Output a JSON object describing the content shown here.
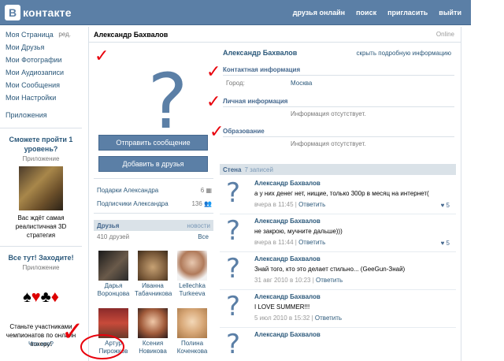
{
  "header": {
    "logo_letter": "В",
    "logo_text": "контакте",
    "nav": [
      "друзья онлайн",
      "поиск",
      "пригласить",
      "выйти"
    ]
  },
  "leftmenu": {
    "items": [
      "Моя Страница",
      "Мои Друзья",
      "Мои Фотографии",
      "Мои Аудиозаписи",
      "Мои Сообщения",
      "Мои Настройки"
    ],
    "edit": "ред.",
    "apps": "Приложения"
  },
  "ads": [
    {
      "title": "Сможете пройти 1 уровень?",
      "sub": "Приложение",
      "text": "Вас ждёт самая реалистичная 3D стратегия"
    },
    {
      "title": "Все тут! Заходите!",
      "sub": "Приложение",
      "text": "Станьте участниками чемпионатов по онлайн покеру!"
    }
  ],
  "whatisit": "Что это?",
  "profile": {
    "name": "Александр Бахвалов",
    "status": "Online",
    "send_message": "Отправить сообщение",
    "add_friend": "Добавить в друзья",
    "gifts_label": "Подарки Александра",
    "gifts_count": "6",
    "subs_label": "Подписчики Александра",
    "subs_count": "136"
  },
  "friends": {
    "title": "Друзья",
    "new": "новости",
    "count": "410 друзей",
    "all": "Все",
    "list": [
      {
        "first": "Дарья",
        "last": "Воронцова"
      },
      {
        "first": "Иванна",
        "last": "Табачникова"
      },
      {
        "first": "Lellechka",
        "last": "Turkeeva"
      },
      {
        "first": "Артур",
        "last": "Пирожков"
      },
      {
        "first": "Ксения",
        "last": "Новикова"
      },
      {
        "first": "Полина",
        "last": "Коченкова"
      }
    ]
  },
  "info": {
    "name": "Александр Бахвалов",
    "hide": "скрыть подробную информацию",
    "contact": "Контактная информация",
    "city_label": "Город:",
    "city": "Москва",
    "personal": "Личная информация",
    "none1": "Информация отсутствует.",
    "education": "Образование",
    "none2": "Информация отсутствует."
  },
  "wall": {
    "title": "Стена",
    "count": "7 записей",
    "posts": [
      {
        "author": "Александр Бахвалов",
        "text": "а у них денег нет, нищие, только 300р в месяц на интернет(",
        "date": "вчера в 11:45",
        "reply": "Ответить",
        "likes": "5"
      },
      {
        "author": "Александр Бахвалов",
        "text": "не закрою, мучните дальше)))",
        "date": "вчера в 11:44",
        "reply": "Ответить",
        "likes": "5"
      },
      {
        "author": "Александр Бахвалов",
        "text": "Знай того, кто это делает стильно... (GeeGun-Знай)",
        "date": "31 авг 2010 в 10:23",
        "reply": "Ответить",
        "likes": ""
      },
      {
        "author": "Александр Бахвалов",
        "text": "I LOVE SUMMER!!!",
        "date": "5 июл 2010 в 15:32",
        "reply": "Ответить",
        "likes": ""
      },
      {
        "author": "Александр Бахвалов",
        "text": "",
        "date": "",
        "reply": "",
        "likes": ""
      }
    ]
  },
  "colors": {
    "brand": "#5b7fa6",
    "link": "#2b587a",
    "annotation": "#e8000b"
  }
}
